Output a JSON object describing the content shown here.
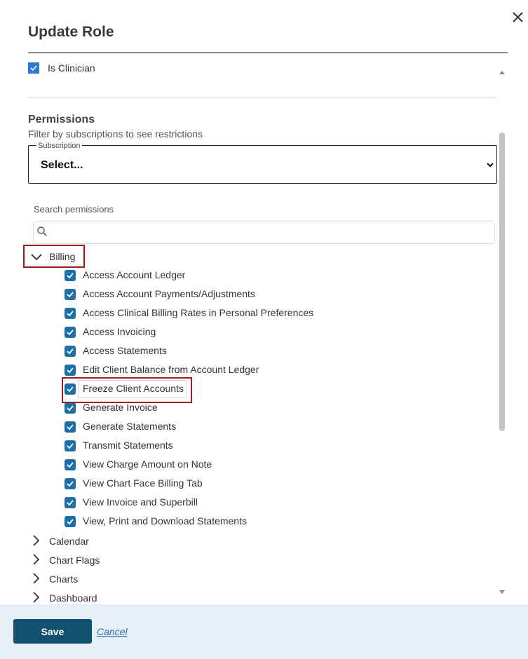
{
  "dialog": {
    "title": "Update Role"
  },
  "clinician": {
    "label": "Is Clinician",
    "checked": true
  },
  "permissions": {
    "heading": "Permissions",
    "subtitle": "Filter by subscriptions to see restrictions",
    "subscription": {
      "legend": "Subscription",
      "value": "Select..."
    },
    "search": {
      "label": "Search permissions",
      "placeholder": ""
    },
    "groups": [
      {
        "name": "Billing",
        "expanded": true,
        "items": [
          {
            "label": "Access Account Ledger",
            "checked": true
          },
          {
            "label": "Access Account Payments/Adjustments",
            "checked": true
          },
          {
            "label": "Access Clinical Billing Rates in Personal Preferences",
            "checked": true
          },
          {
            "label": "Access Invoicing",
            "checked": true
          },
          {
            "label": "Access Statements",
            "checked": true
          },
          {
            "label": "Edit Client Balance from Account Ledger",
            "checked": true
          },
          {
            "label": "Freeze Client Accounts",
            "checked": true
          },
          {
            "label": "Generate Invoice",
            "checked": true
          },
          {
            "label": "Generate Statements",
            "checked": true
          },
          {
            "label": "Transmit Statements",
            "checked": true
          },
          {
            "label": "View Charge Amount on Note",
            "checked": true
          },
          {
            "label": "View Chart Face Billing Tab",
            "checked": true
          },
          {
            "label": "View Invoice and Superbill",
            "checked": true
          },
          {
            "label": "View, Print and Download Statements",
            "checked": true
          }
        ]
      },
      {
        "name": "Calendar",
        "expanded": false
      },
      {
        "name": "Chart Flags",
        "expanded": false
      },
      {
        "name": "Charts",
        "expanded": false
      },
      {
        "name": "Dashboard",
        "expanded": false
      }
    ]
  },
  "footer": {
    "save_label": "Save",
    "cancel_label": "Cancel"
  },
  "colors": {
    "checkbox": "#1d6fa8",
    "highlight": "#9b1c1c",
    "save_button": "#12506f",
    "footer_bg": "#e6eef8"
  }
}
